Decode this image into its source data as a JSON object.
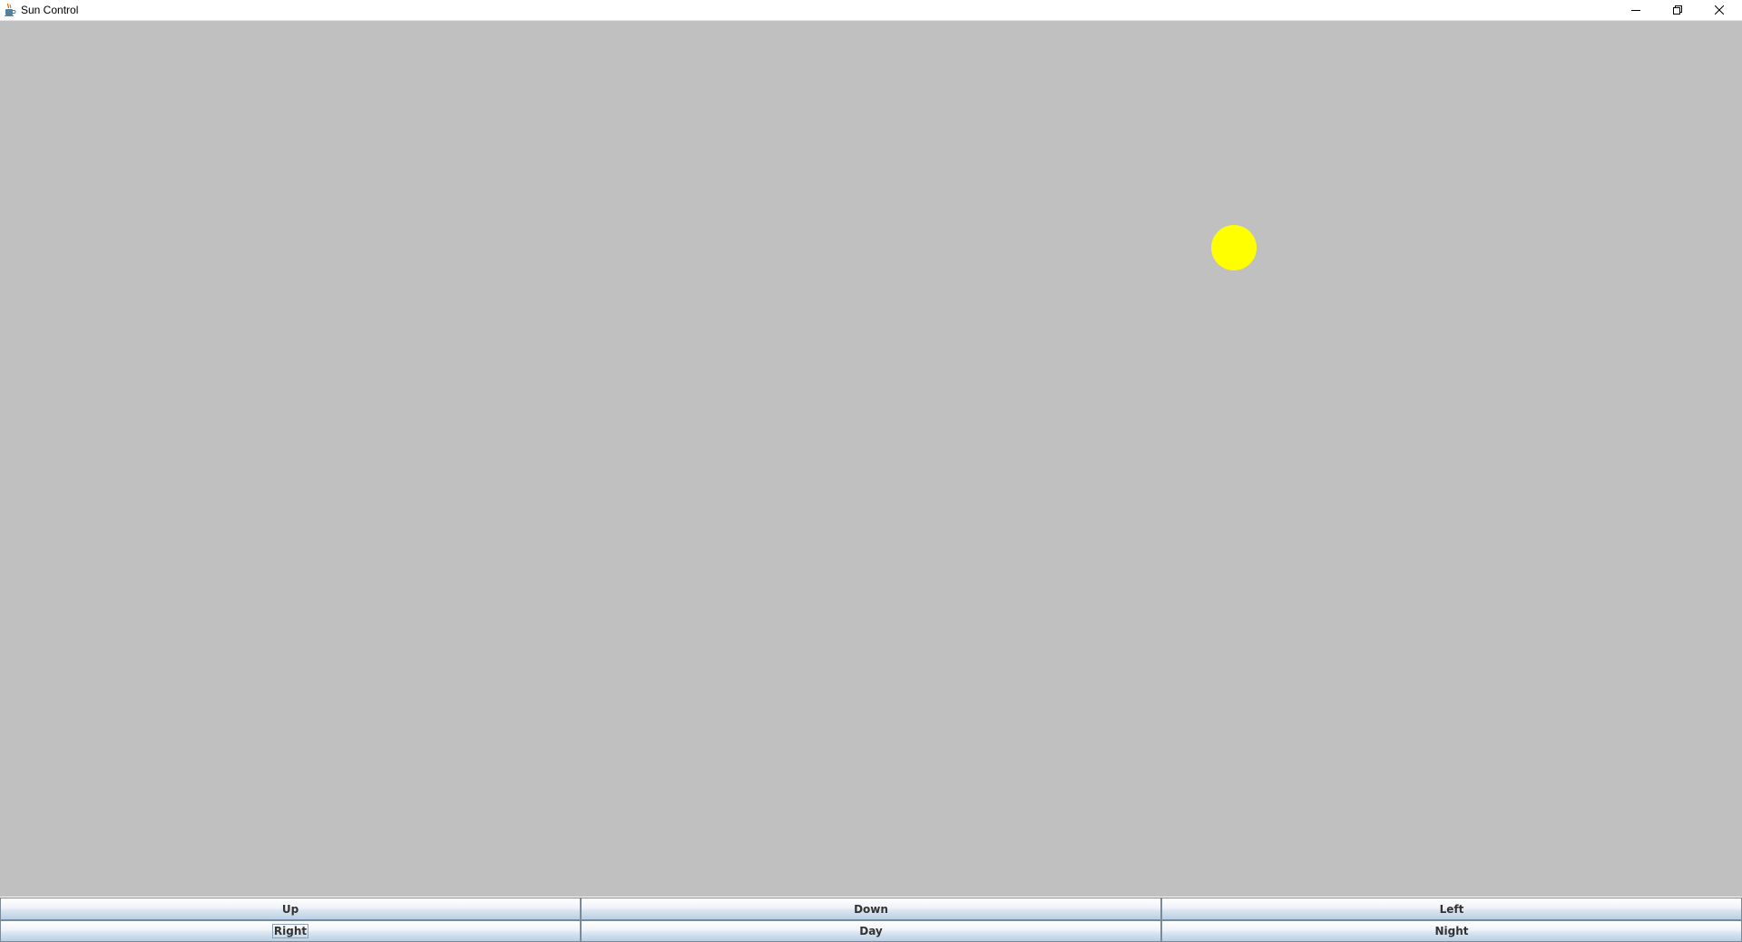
{
  "window": {
    "title": "Sun Control",
    "icon": "java-cup-icon",
    "controls": {
      "minimize_icon": "minimize-icon",
      "restore_icon": "restore-icon",
      "close_icon": "close-icon"
    }
  },
  "scene": {
    "background_color": "#c0c0c0",
    "sun_color": "#ffff00"
  },
  "buttons": {
    "up": "Up",
    "down": "Down",
    "left": "Left",
    "right": "Right",
    "day": "Day",
    "night": "Night"
  }
}
